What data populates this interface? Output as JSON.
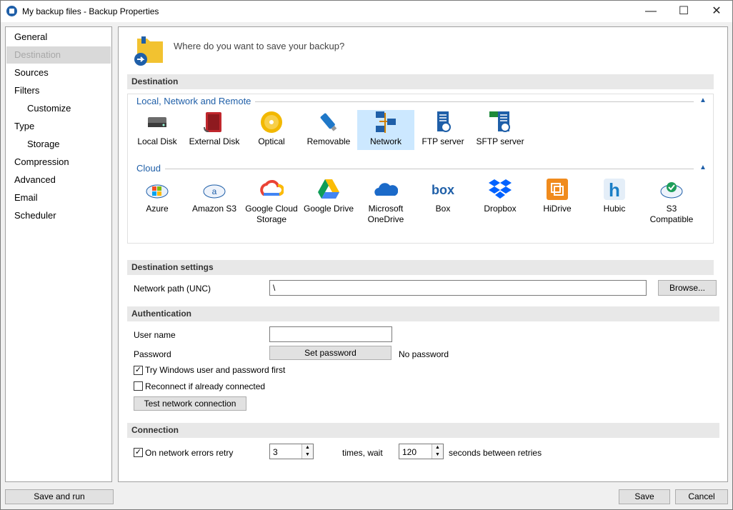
{
  "window": {
    "title": "My backup files - Backup Properties",
    "minimize": "—",
    "maximize": "☐",
    "close": "✕"
  },
  "nav": [
    "General",
    "Destination",
    "Sources",
    "Filters",
    "Customize",
    "Type",
    "Storage",
    "Compression",
    "Advanced",
    "Email",
    "Scheduler"
  ],
  "header": {
    "question": "Where do you want to save your backup?"
  },
  "destination": {
    "section": "Destination",
    "local_group": "Local, Network and Remote",
    "local_items": [
      "Local Disk",
      "External Disk",
      "Optical",
      "Removable",
      "Network",
      "FTP server",
      "SFTP server"
    ],
    "selected": "Network",
    "cloud_group": "Cloud",
    "cloud_items": [
      [
        "Azure",
        ""
      ],
      [
        "Amazon S3",
        ""
      ],
      [
        "Google Cloud",
        "Storage"
      ],
      [
        "Google Drive",
        ""
      ],
      [
        "Microsoft",
        "OneDrive"
      ],
      [
        "Box",
        ""
      ],
      [
        "Dropbox",
        ""
      ],
      [
        "HiDrive",
        ""
      ],
      [
        "Hubic",
        ""
      ],
      [
        "S3",
        "Compatible"
      ]
    ]
  },
  "settings": {
    "section": "Destination settings",
    "path_label": "Network path (UNC)",
    "path_value": "\\",
    "browse": "Browse..."
  },
  "auth": {
    "section": "Authentication",
    "user_label": "User name",
    "user_value": "",
    "password_label": "Password",
    "set_password": "Set password",
    "password_status": "No password",
    "try_windows": "Try Windows user and password first",
    "try_windows_checked": true,
    "reconnect": "Reconnect if already connected",
    "reconnect_checked": false,
    "test": "Test network connection"
  },
  "connection": {
    "section": "Connection",
    "retry_label": "On network errors retry",
    "retry_checked": true,
    "retry_value": "3",
    "times_wait": "times, wait",
    "wait_value": "120",
    "seconds": "seconds between retries"
  },
  "footer": {
    "save_run": "Save and run",
    "save": "Save",
    "cancel": "Cancel"
  }
}
